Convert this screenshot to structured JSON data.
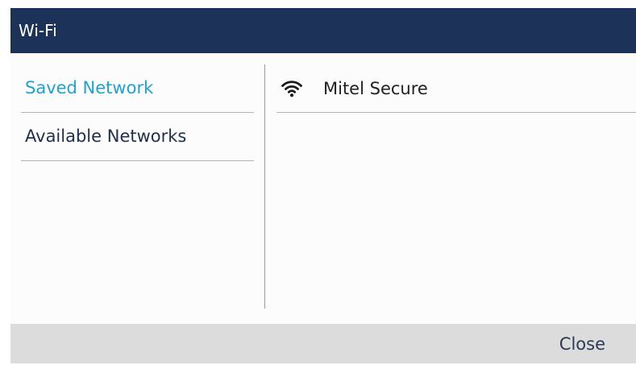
{
  "title": "Wi-Fi",
  "menu": {
    "items": [
      {
        "label": "Saved Network",
        "selected": true
      },
      {
        "label": "Available Networks",
        "selected": false
      }
    ]
  },
  "networks": [
    {
      "name": "Mitel Secure",
      "icon": "wifi-icon"
    }
  ],
  "softkeys": {
    "close_label": "Close"
  },
  "colors": {
    "titlebar": "#1c3258",
    "selected_item": "#1fa2d6",
    "softkey_bar": "#dcdcdc"
  }
}
